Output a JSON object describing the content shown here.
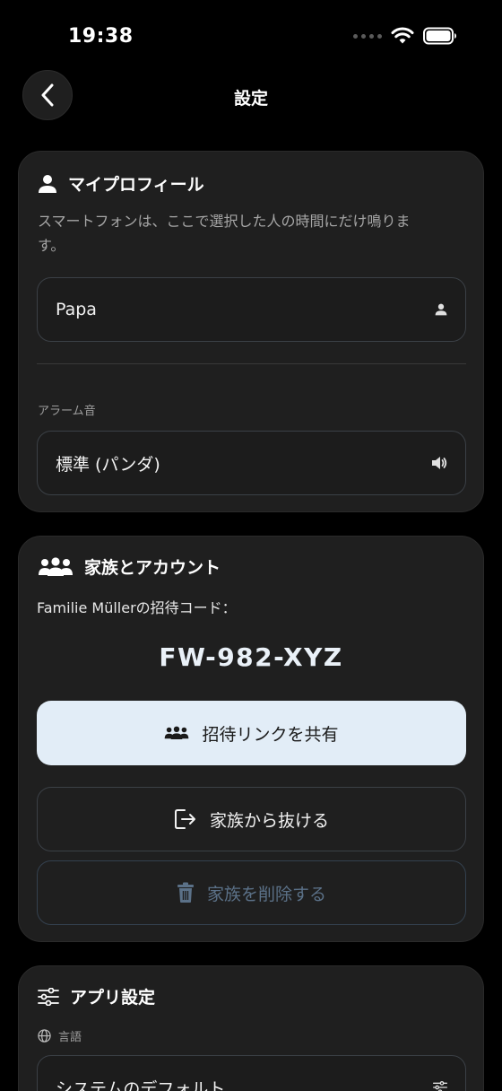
{
  "status_bar": {
    "time": "19:38"
  },
  "nav": {
    "title": "設定"
  },
  "profile": {
    "title": "マイプロフィール",
    "description": "スマートフォンは、ここで選択した人の時間にだけ鳴ります。",
    "name_value": "Papa",
    "alarm_label": "アラーム音",
    "alarm_value": "標準 (パンダ)"
  },
  "family": {
    "title": "家族とアカウント",
    "invite_label": "Familie Müllerの招待コード：",
    "invite_code": "FW-982-XYZ",
    "share_label": "招待リンクを共有",
    "leave_label": "家族から抜ける",
    "delete_label": "家族を削除する"
  },
  "app_settings": {
    "title": "アプリ設定",
    "language_label": "言語",
    "language_value": "システムのデフォルト"
  },
  "colors": {
    "background": "#000000",
    "card": "#1f1f1f",
    "primary_button": "#e2edf7",
    "danger_text": "#5b7188"
  },
  "icons": [
    "chevron-left-icon",
    "person-icon",
    "speaker-icon",
    "group-icon",
    "logout-icon",
    "trash-icon",
    "sliders-icon",
    "globe-icon",
    "wifi-icon",
    "battery-icon"
  ]
}
